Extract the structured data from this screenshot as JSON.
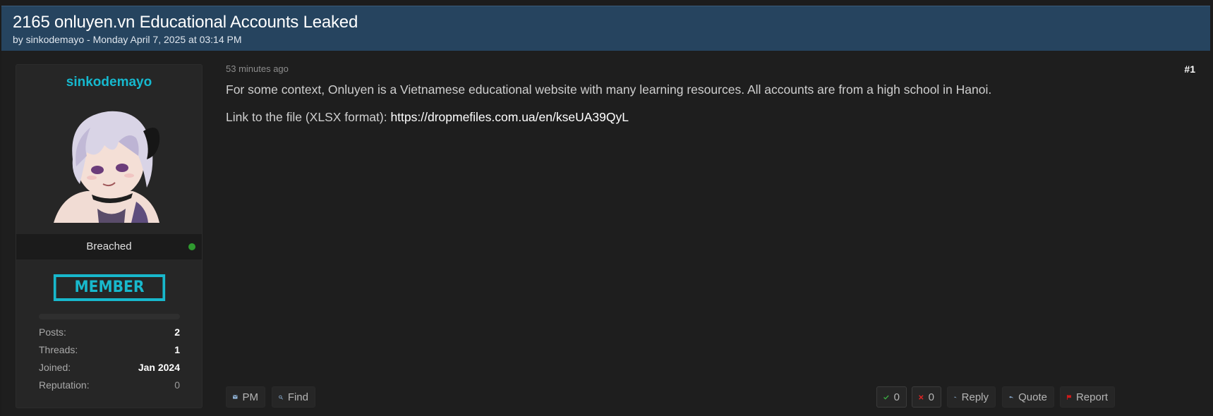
{
  "thread": {
    "title": "2165 onluyen.vn Educational Accounts Leaked",
    "meta": "by sinkodemayo - Monday April 7, 2025 at 03:14 PM"
  },
  "author": {
    "username": "sinkodemayo",
    "status": "Breached",
    "online": true,
    "rank": "MEMBER",
    "stats": [
      {
        "label": "Posts:",
        "value": "2"
      },
      {
        "label": "Threads:",
        "value": "1"
      },
      {
        "label": "Joined:",
        "value": "Jan 2024"
      },
      {
        "label": "Reputation:",
        "value": "0"
      }
    ]
  },
  "post": {
    "timestamp": "53 minutes ago",
    "number": "#1",
    "paragraph1": "For some context, Onluyen is a Vietnamese educational website with many learning resources. All accounts are from a high school in Hanoi.",
    "link_prefix": "Link to the file (XLSX format): ",
    "link_text": "https://dropmefiles.com.ua/en/kseUA39QyL"
  },
  "actions": {
    "pm": "PM",
    "find": "Find",
    "upvotes": "0",
    "downvotes": "0",
    "reply": "Reply",
    "quote": "Quote",
    "report": "Report"
  },
  "colors": {
    "header_bg": "#26445f",
    "username": "#16b9cf",
    "rank_badge": "#18b8cc",
    "online": "#2f9a2f",
    "upvote": "#3cb043",
    "downvote": "#e02424",
    "report_flag": "#d11a1a",
    "action_icon": "#8fb2d6"
  },
  "icons": [
    "envelope-icon",
    "search-icon",
    "check-icon",
    "x-icon",
    "reply-icon",
    "quote-icon",
    "flag-icon"
  ]
}
